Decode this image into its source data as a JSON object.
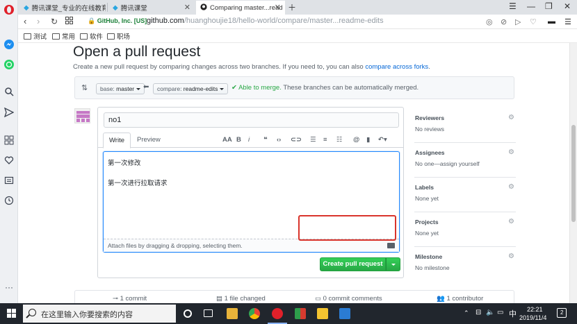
{
  "browser": {
    "tabs": [
      {
        "label": "腾讯课堂_专业的在线教育",
        "active": false
      },
      {
        "label": "腾讯课堂",
        "active": false
      },
      {
        "label": "Comparing master...read",
        "active": true
      }
    ],
    "secure_label": "GitHub, Inc. [US]",
    "url_host": "github.com",
    "url_path": "/huanghoujie18/hello-world/compare/master...readme-edits",
    "bookmarks": [
      "测试",
      "常用",
      "软件",
      "职场"
    ]
  },
  "page": {
    "title": "Open a pull request",
    "subtitle_prefix": "Create a new pull request by comparing changes across two branches. If you need to, you can also ",
    "subtitle_link": "compare across forks",
    "subtitle_suffix": ".",
    "base_muted": "base: ",
    "base_branch": "master",
    "compare_muted": "compare: ",
    "compare_branch": "readme-edits",
    "merge_ok": "✔ Able to merge.",
    "merge_msg": " These branches can be automatically merged."
  },
  "form": {
    "title_value": "no1",
    "tab_write": "Write",
    "tab_preview": "Preview",
    "body_lines": [
      "第一次修改",
      "第一次进行拉取请求"
    ],
    "attach_text": "Attach files by dragging & dropping, selecting them.",
    "create_button": "Create pull request"
  },
  "sidebar": [
    {
      "title": "Reviewers",
      "value": "No reviews"
    },
    {
      "title": "Assignees",
      "value": "No one—assign yourself"
    },
    {
      "title": "Labels",
      "value": "None yet"
    },
    {
      "title": "Projects",
      "value": "None yet"
    },
    {
      "title": "Milestone",
      "value": "No milestone"
    }
  ],
  "stats": {
    "commits": "1 commit",
    "files": "1 file changed",
    "comments": "0 commit comments",
    "contributors": "1 contributor"
  },
  "taskbar": {
    "search_placeholder": "在这里输入你要搜索的内容",
    "ime": "中",
    "time": "22:21",
    "date": "2019/11/4",
    "notification_count": "2"
  },
  "colors": {
    "accent": "#0366d6",
    "success": "#28a745",
    "highlight": "#d9342b"
  }
}
